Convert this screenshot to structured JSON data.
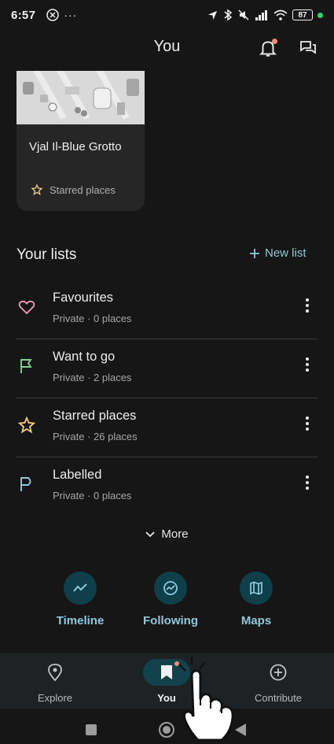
{
  "status_bar": {
    "time": "6:57",
    "battery": "87"
  },
  "header": {
    "title": "You"
  },
  "card": {
    "name": "Vjal Il-Blue Grotto",
    "tag": "Starred places"
  },
  "lists_section": {
    "title": "Your lists",
    "new_list_label": "New list"
  },
  "lists": [
    {
      "name": "Favourites",
      "meta": "Private · 0 places",
      "icon": "heart-icon",
      "color": "#f19ab8"
    },
    {
      "name": "Want to go",
      "meta": "Private · 2 places",
      "icon": "flag-icon",
      "color": "#7fcf93"
    },
    {
      "name": "Starred places",
      "meta": "Private · 26 places",
      "icon": "star-icon",
      "color": "#f1c97a"
    },
    {
      "name": "Labelled",
      "meta": "Private · 0 places",
      "icon": "label-flag-icon",
      "color": "#8fc8dc"
    }
  ],
  "more_label": "More",
  "quick_actions": [
    {
      "label": "Timeline",
      "icon": "timeline-icon"
    },
    {
      "label": "Following",
      "icon": "following-icon"
    },
    {
      "label": "Maps",
      "icon": "map-icon"
    }
  ],
  "bottom_nav": [
    {
      "label": "Explore",
      "icon": "location-pin-icon"
    },
    {
      "label": "You",
      "icon": "bookmark-icon",
      "active": true
    },
    {
      "label": "Contribute",
      "icon": "add-circle-icon"
    }
  ],
  "colors": {
    "accent": "#8fc8dc",
    "background": "#161616",
    "notification_dot": "#f08d7b"
  }
}
